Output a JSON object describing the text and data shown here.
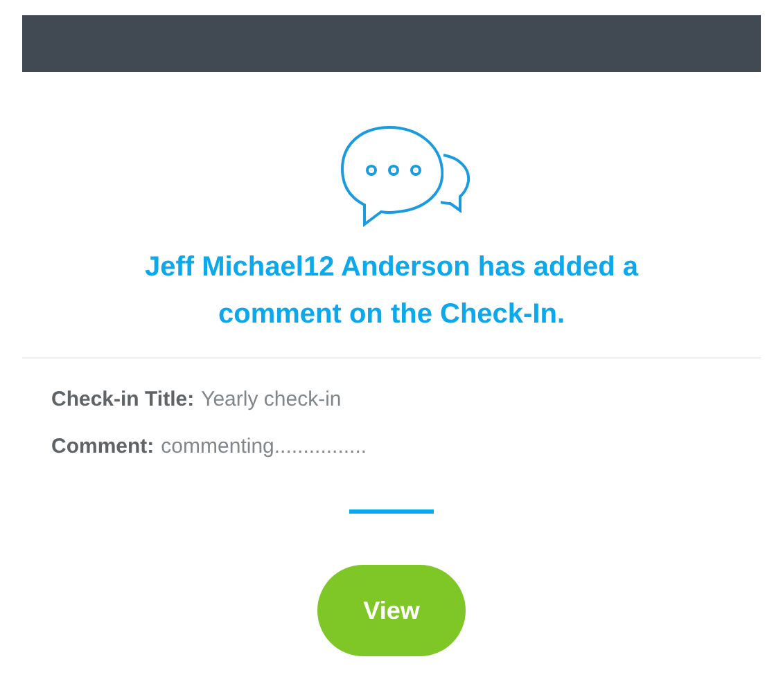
{
  "notification": {
    "headline": "Jeff Michael12 Anderson has added a comment on the Check-In.",
    "fields": [
      {
        "label": "Check-in Title:",
        "value": "Yearly check-in"
      },
      {
        "label": "Comment:",
        "value": "commenting................"
      }
    ],
    "button": "View"
  }
}
